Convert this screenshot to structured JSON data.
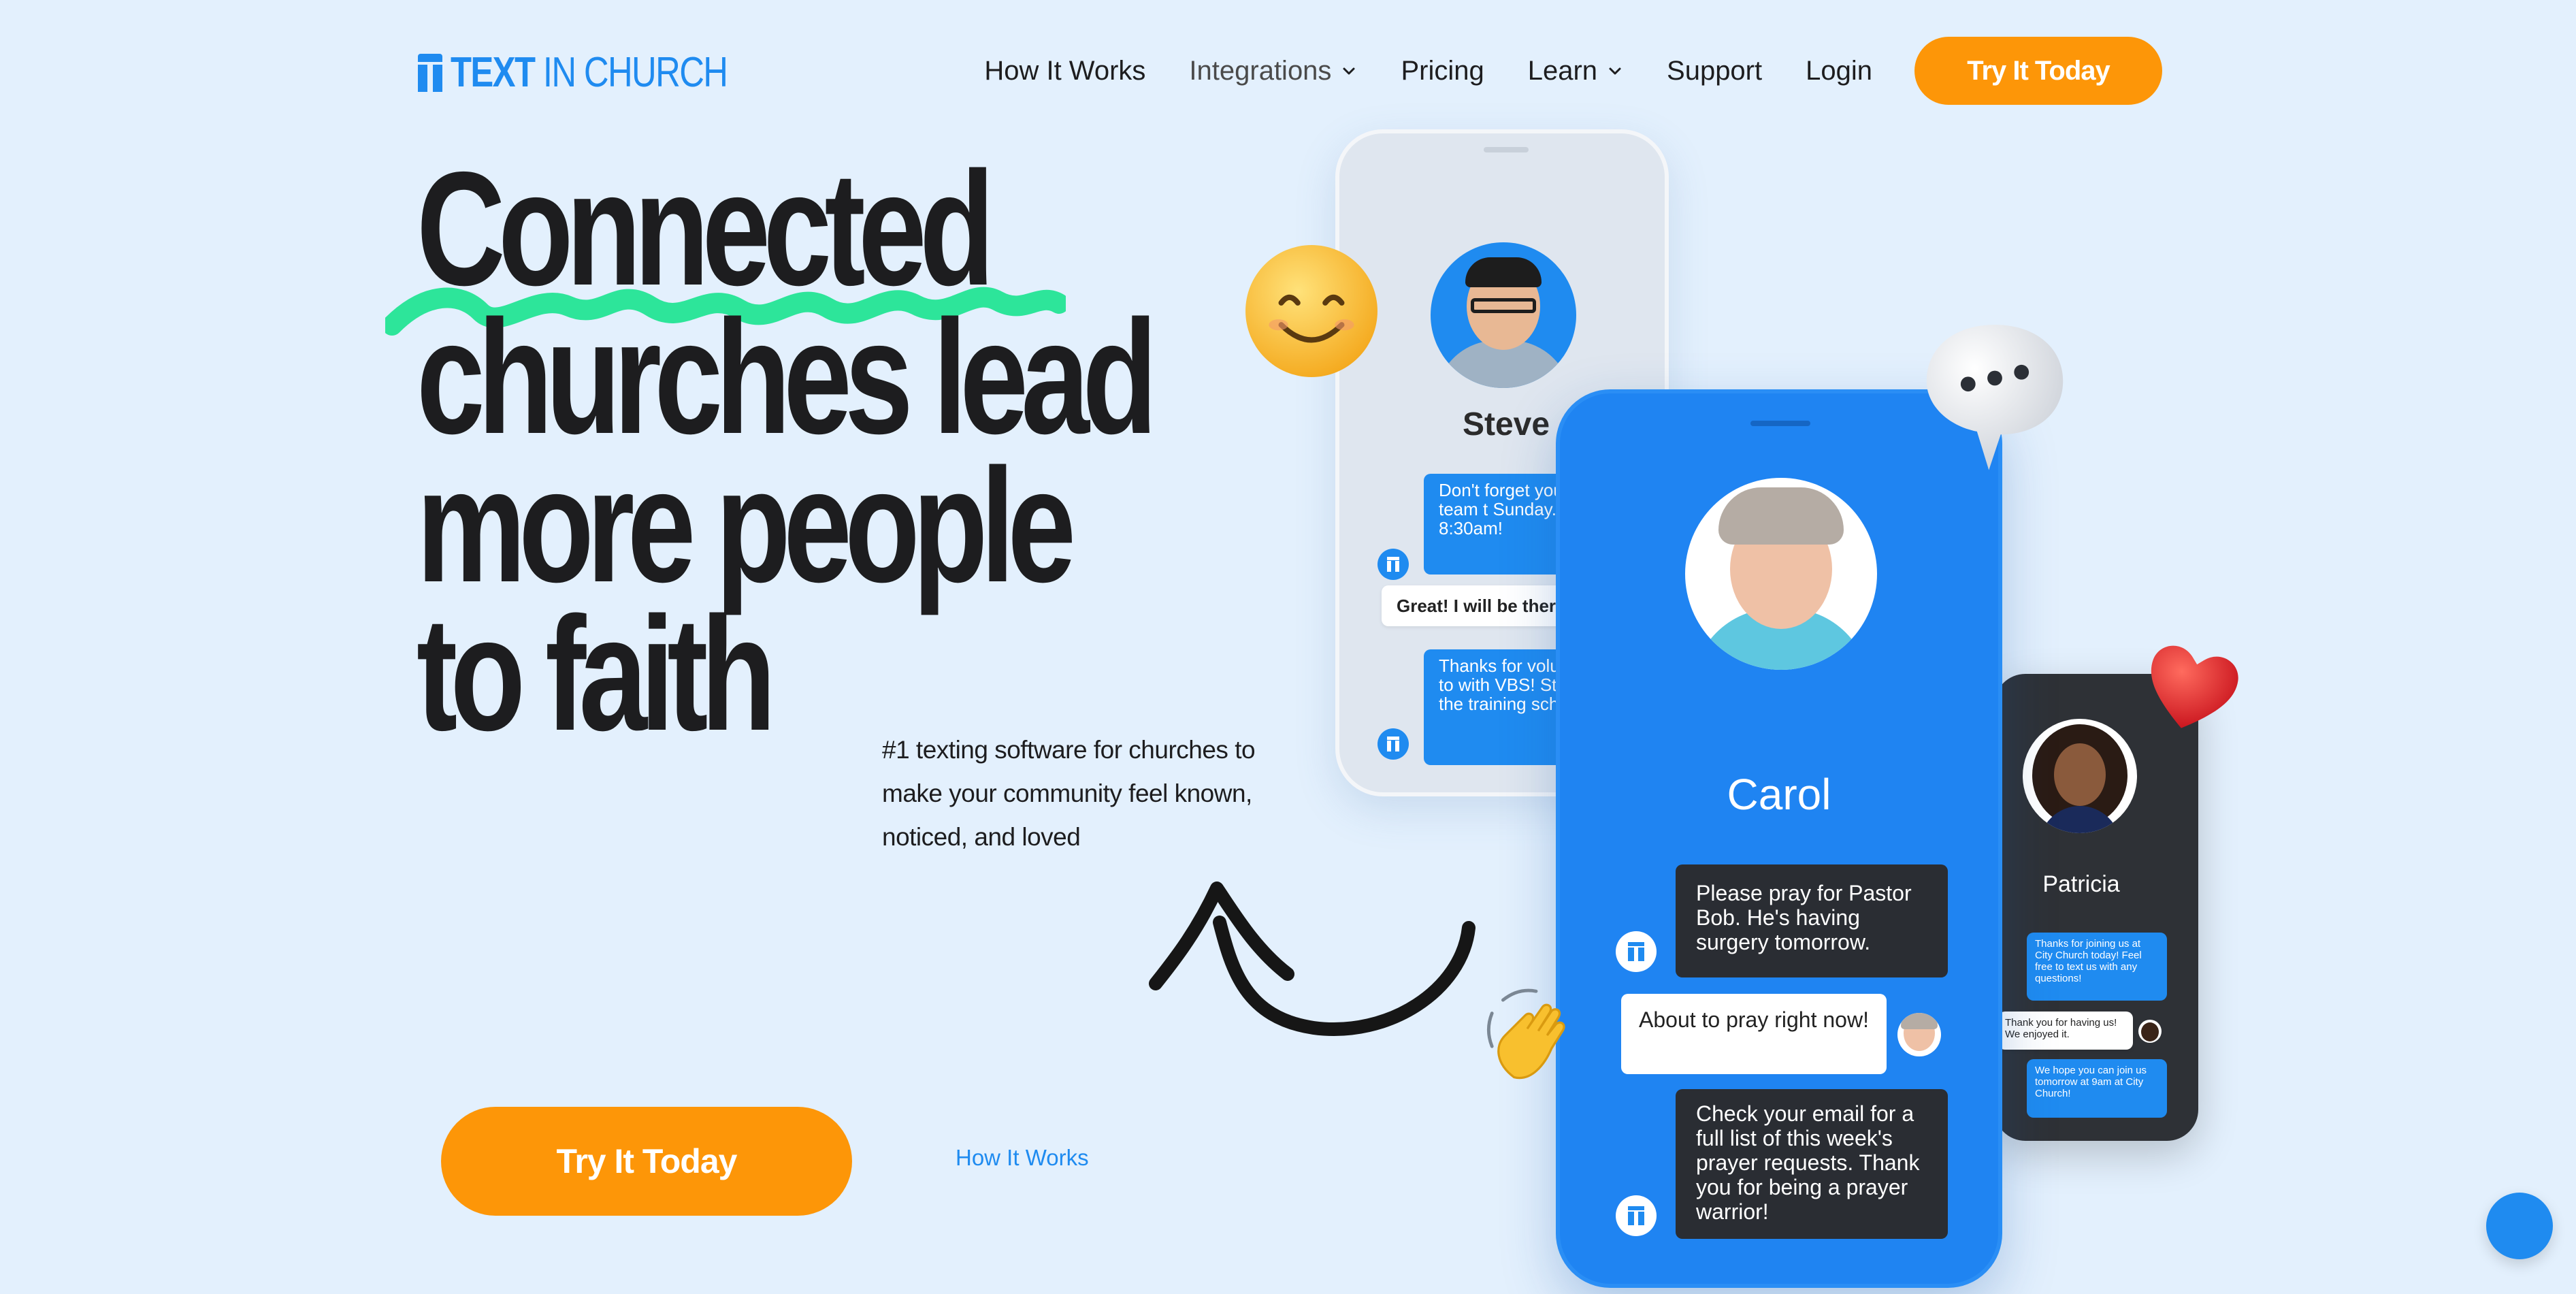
{
  "logo": {
    "brand_bold": "TEXT",
    "brand_light": "IN CHURCH"
  },
  "nav": {
    "items": [
      {
        "label": "How It Works"
      },
      {
        "label": "Integrations"
      },
      {
        "label": "Pricing"
      },
      {
        "label": "Learn"
      },
      {
        "label": "Support"
      },
      {
        "label": "Login"
      }
    ],
    "cta": "Try It Today"
  },
  "hero": {
    "headline": [
      "Connected",
      "churches lead",
      "more people",
      "to faith"
    ],
    "subtext": "#1 texting software for churches to make your community feel known, noticed, and loved",
    "cta": "Try It Today",
    "link": "How It Works"
  },
  "phones": {
    "back": {
      "name": "Steve",
      "messages": [
        "Don't forget you greeting team t Sunday. See yo 8:30am!",
        "Great! I will be there.",
        "Thanks for volunteering to with VBS! Stay t for the training schedule."
      ]
    },
    "main": {
      "name": "Carol",
      "messages": [
        "Please pray for Pastor Bob. He's having surgery tomorrow.",
        "About to pray right now!",
        "Check your email for a full list of this week's prayer requests. Thank you for being a prayer warrior!"
      ]
    },
    "right": {
      "name": "Patricia",
      "messages": [
        "Thanks for joining us at City Church today! Feel free to text us with any questions!",
        "Thank you for having us! We enjoyed it.",
        "We hope you can join us tomorrow at 9am at City Church!"
      ]
    }
  },
  "colors": {
    "background": "#e3f0fd",
    "brand_blue": "#1f8bf0",
    "cta_orange": "#fd9608",
    "squiggle_green": "#2de59a"
  },
  "icons": [
    "chevron-down-icon",
    "smile-emoji-icon",
    "speech-bubble-icon",
    "heart-emoji-icon",
    "wave-hand-icon",
    "hand-drawn-arrow-icon",
    "chat-widget-icon"
  ]
}
